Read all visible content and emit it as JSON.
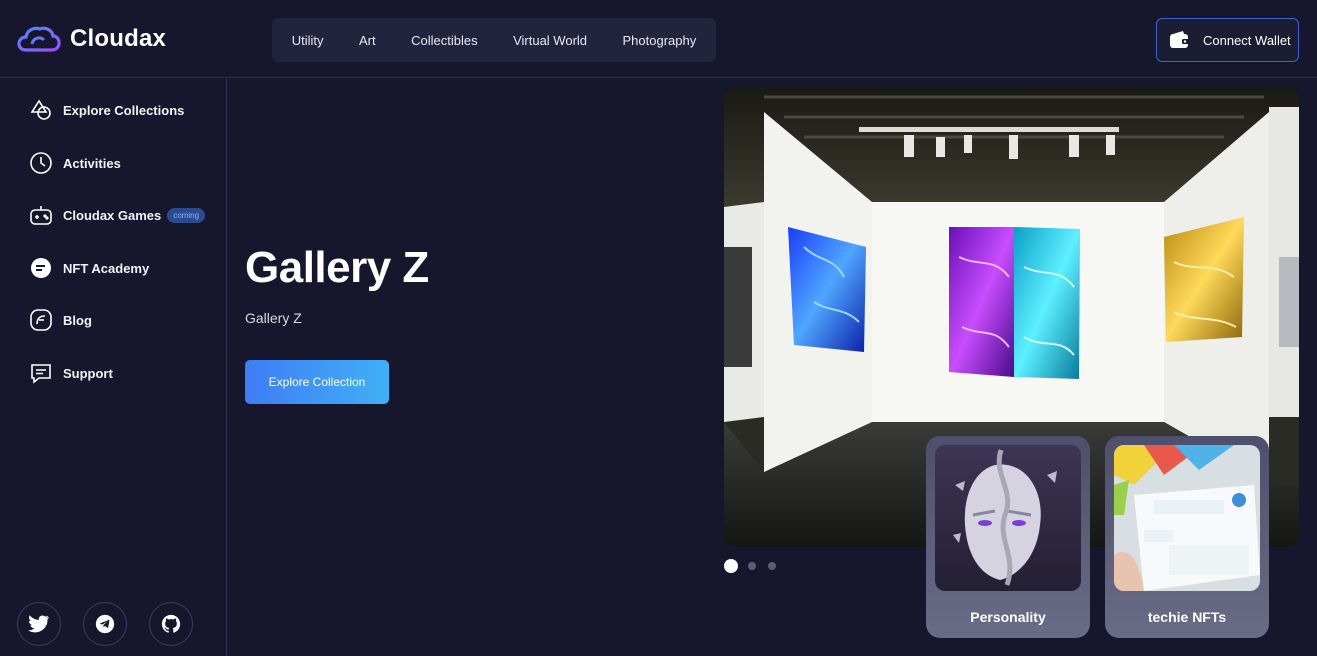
{
  "brand": {
    "name": "Cloudax"
  },
  "topnav": {
    "items": [
      "Utility",
      "Art",
      "Collectibles",
      "Virtual World",
      "Photography"
    ]
  },
  "wallet": {
    "label": "Connect Wallet"
  },
  "sidebar": {
    "items": [
      {
        "label": "Explore Collections",
        "icon": "collections-icon"
      },
      {
        "label": "Activities",
        "icon": "clock-icon"
      },
      {
        "label": "Cloudax Games",
        "icon": "gamepad-icon",
        "badge": "coming"
      },
      {
        "label": "NFT Academy",
        "icon": "academy-icon"
      },
      {
        "label": "Blog",
        "icon": "blog-icon"
      },
      {
        "label": "Support",
        "icon": "chat-icon"
      }
    ],
    "social": [
      "twitter-icon",
      "telegram-icon",
      "github-icon"
    ]
  },
  "hero": {
    "title": "Gallery Z",
    "subtitle": "Gallery Z",
    "button": "Explore Collection"
  },
  "carousel": {
    "slides": 3,
    "active": 1
  },
  "cards": [
    {
      "label": "Personality"
    },
    {
      "label": "techie NFTs"
    }
  ],
  "colors": {
    "background": "#16172c",
    "accent": "#3f7df5",
    "accent2": "#3fb0f5",
    "wallet_border": "#3a63c9"
  }
}
